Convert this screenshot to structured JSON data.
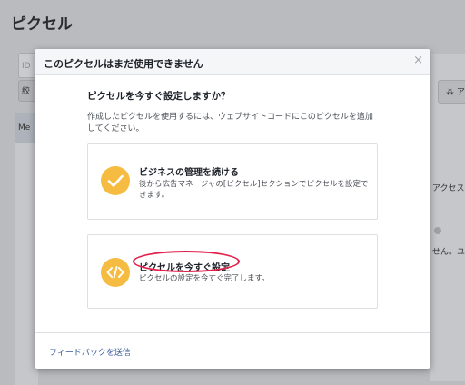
{
  "background": {
    "page_title": "ピクセル",
    "input_fragment": "ID",
    "button_fragment": "絞",
    "sidebar_fragment": "Me",
    "right_button_fragment": "ア",
    "right_text1": "アクセス",
    "right_text2": "せん。ユ"
  },
  "modal": {
    "title": "このピクセルはまだ使用できません",
    "close_glyph": "×",
    "question": "ピクセルを今すぐ設定しますか？",
    "description": "作成したピクセルを使用するには、ウェブサイトコードにこのピクセルを追加してください。",
    "options": [
      {
        "title": "ビジネスの管理を続ける",
        "description": "後から広告マネージャの[ピクセル]セクションでピクセルを設定できます。",
        "icon": "checkmark-icon"
      },
      {
        "title": "ピクセルを今すぐ設定",
        "description": "ピクセルの設定を今すぐ完了します。",
        "icon": "code-icon"
      }
    ],
    "feedback_link": "フィードバックを送信"
  },
  "colors": {
    "icon_circle": "#f5bc41",
    "highlight_ellipse": "#e2204b",
    "link": "#365899"
  }
}
